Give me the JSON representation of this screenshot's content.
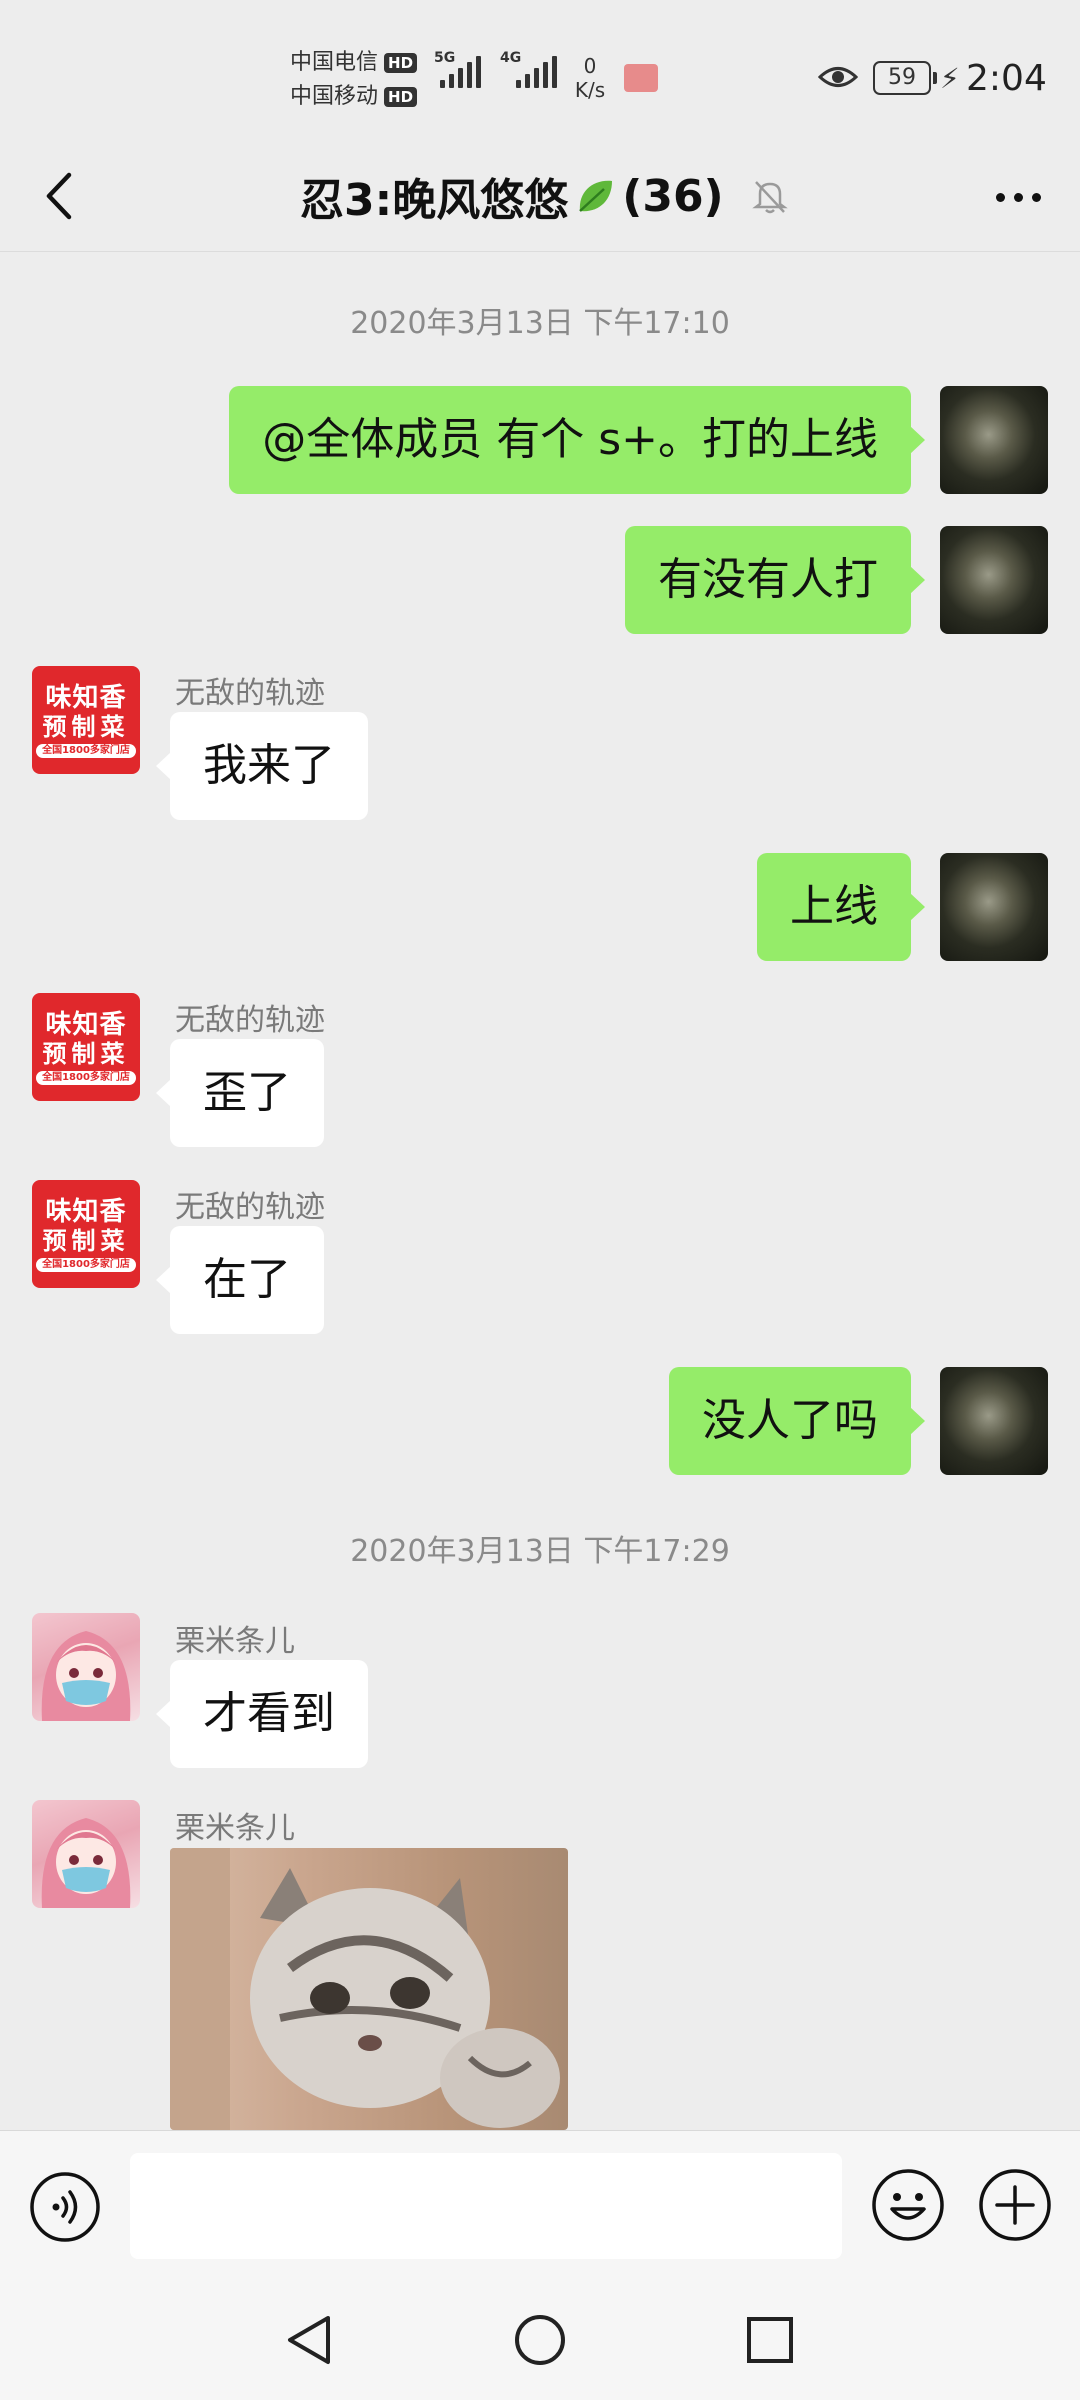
{
  "status_bar": {
    "carrier1": "中国电信",
    "carrier2": "中国移动",
    "hd": "HD",
    "net1": "5G",
    "net2": "4G",
    "speed_value": "0",
    "speed_unit": "K/s",
    "battery": "59",
    "time": "2:04"
  },
  "header": {
    "title": "忍3:晚风悠悠",
    "member_count": "(36)",
    "icons": [
      "back-arrow-icon",
      "leaf-emoji-icon",
      "mute-bell-icon",
      "more-icon"
    ]
  },
  "timestamps": [
    "2020年3月13日 下午17:10",
    "2020年3月13日 下午17:29"
  ],
  "messages": [
    {
      "direction": "out",
      "text": "@全体成员  有个 s+。打的上线"
    },
    {
      "direction": "out",
      "text": "有没有人打"
    },
    {
      "direction": "in",
      "sender": "无敌的轨迹",
      "text": "我来了"
    },
    {
      "direction": "out",
      "text": "上线"
    },
    {
      "direction": "in",
      "sender": "无敌的轨迹",
      "text": "歪了"
    },
    {
      "direction": "in",
      "sender": "无敌的轨迹",
      "text": "在了"
    },
    {
      "direction": "out",
      "text": "没人了吗"
    },
    {
      "direction": "in",
      "sender": "栗米条儿",
      "text": "才看到"
    },
    {
      "direction": "in",
      "sender": "栗米条儿",
      "type": "sticker",
      "content": "cat-sticker-image"
    }
  ],
  "avatar_brand": {
    "line1": "味知香",
    "line2": "预制菜",
    "line3": "全国1800多家门店"
  },
  "input_bar": {
    "value": "",
    "icons": [
      "voice-icon",
      "emoji-icon",
      "plus-icon"
    ]
  },
  "nav_bar": {
    "icons": [
      "nav-back-icon",
      "nav-home-icon",
      "nav-recent-icon"
    ]
  },
  "colors": {
    "background": "#ededed",
    "outgoing_bubble": "#95ec69",
    "incoming_bubble": "#ffffff",
    "brand_avatar": "#e0282c"
  }
}
